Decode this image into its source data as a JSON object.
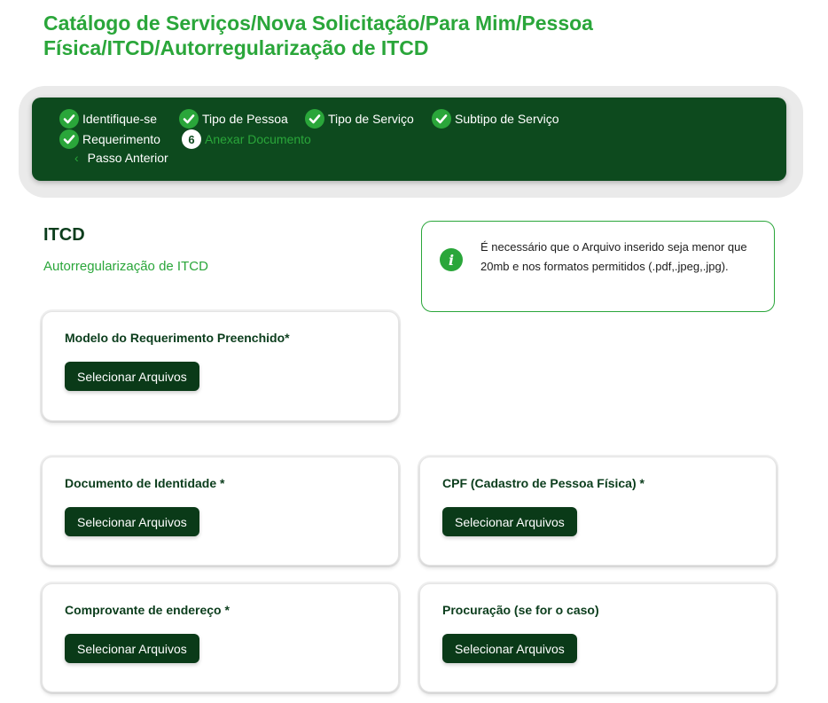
{
  "page": {
    "title": "Catálogo de Serviços/Nova Solicitação/Para Mim/Pessoa Física/ITCD/Autorregularização de ITCD"
  },
  "stepper": {
    "steps": [
      {
        "label": "Identifique-se",
        "status": "done"
      },
      {
        "label": "Tipo de Pessoa",
        "status": "done"
      },
      {
        "label": "Tipo de Serviço",
        "status": "done"
      },
      {
        "label": "Subtipo de Serviço",
        "status": "done"
      },
      {
        "label": "Requerimento",
        "status": "done"
      },
      {
        "label": "Anexar Documento",
        "status": "current",
        "number": "6"
      }
    ],
    "prev_label": "Passo Anterior"
  },
  "section": {
    "title": "ITCD",
    "subtitle": "Autorregularização de ITCD"
  },
  "info": {
    "icon": "info-icon",
    "text": "É necessário que o Arquivo inserido seja menor que 20mb e nos formatos permitidos (.pdf,.jpeg,.jpg)."
  },
  "uploads": [
    {
      "label": "Modelo do Requerimento Preenchido*",
      "button": "Selecionar Arquivos"
    },
    {
      "label": "Documento de Identidade *",
      "button": "Selecionar Arquivos"
    },
    {
      "label": "CPF (Cadastro de Pessoa Física) *",
      "button": "Selecionar Arquivos"
    },
    {
      "label": "Comprovante de endereço *",
      "button": "Selecionar Arquivos"
    },
    {
      "label": "Procuração (se for o caso)",
      "button": "Selecionar Arquivos"
    }
  ],
  "colors": {
    "brand_green": "#2aa63a",
    "dark_green": "#0d4a1e",
    "button_dark": "#0a3a18"
  }
}
